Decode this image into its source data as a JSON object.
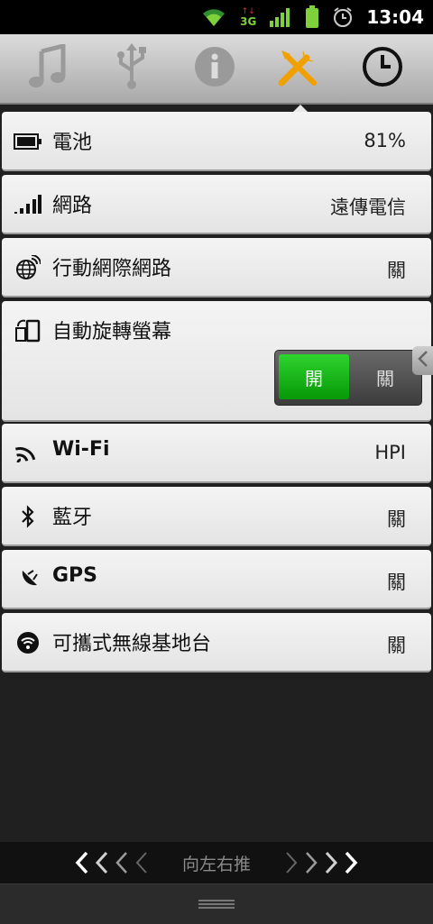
{
  "status_bar": {
    "time": "13:04",
    "network_type": "3G",
    "icons": [
      "wifi-icon",
      "data-3g-icon",
      "signal-icon",
      "battery-icon",
      "alarm-icon"
    ]
  },
  "tabs": [
    {
      "name": "music-icon",
      "active": false
    },
    {
      "name": "usb-icon",
      "active": false
    },
    {
      "name": "info-icon",
      "active": false
    },
    {
      "name": "tools-icon",
      "active": true
    },
    {
      "name": "clock-icon",
      "active": false
    }
  ],
  "rows": {
    "battery": {
      "label": "電池",
      "value": "81%"
    },
    "network": {
      "label": "網路",
      "value": "遠傳電信"
    },
    "mobile_data": {
      "label": "行動網際網路",
      "value": "關"
    },
    "auto_rotate": {
      "label": "自動旋轉螢幕",
      "toggle_on": "開",
      "toggle_off": "關"
    },
    "wifi": {
      "label": "Wi-Fi",
      "value": "HPI"
    },
    "bluetooth": {
      "label": "藍牙",
      "value": "關"
    },
    "gps": {
      "label": "GPS",
      "value": "關"
    },
    "hotspot": {
      "label": "可攜式無線基地台",
      "value": "關"
    }
  },
  "swipe_hint": "向左右推",
  "colors": {
    "active_tab": "#f0a000",
    "toggle_on": "#12b312"
  }
}
